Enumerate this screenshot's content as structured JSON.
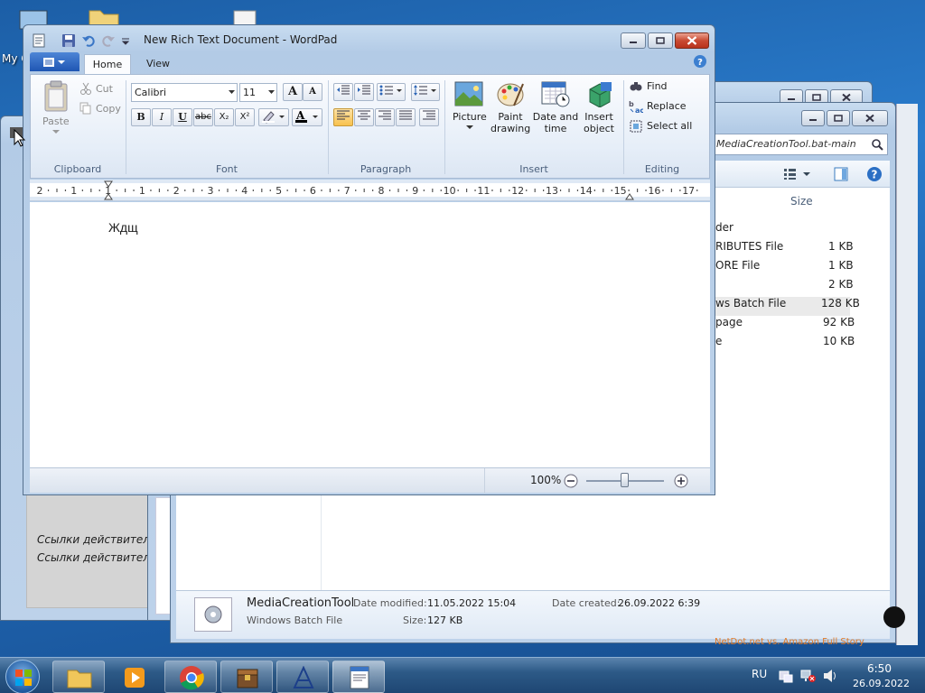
{
  "desktop": {
    "icon_label": "My C"
  },
  "back_window": {
    "italic_lines": [
      "Ссылки действитель",
      "Ссылки действитель"
    ]
  },
  "explorer": {
    "search_text": "MediaCreationTool.bat-main",
    "column_size": "Size",
    "rows": [
      {
        "type": "der",
        "size": ""
      },
      {
        "type": "RIBUTES File",
        "size": "1 KB"
      },
      {
        "type": "ORE File",
        "size": "1 KB"
      },
      {
        "type": "",
        "size": "2 KB"
      },
      {
        "type": "ws Batch File",
        "size": "128 KB"
      },
      {
        "type": "page",
        "size": "92 KB"
      },
      {
        "type": "e",
        "size": "10 KB"
      }
    ],
    "details": {
      "name": "MediaCreationTool",
      "type": "Windows Batch File",
      "modified_label": "Date modified:",
      "modified_value": "11.05.2022 15:04",
      "size_label": "Size:",
      "size_value": "127 KB",
      "created_label": "Date created:",
      "created_value": "26.09.2022 6:39"
    },
    "footer_text": "NetDot.net vs. Amazon Full Story"
  },
  "wordpad": {
    "title": "New Rich Text Document - WordPad",
    "tabs": [
      "Home",
      "View"
    ],
    "clipboard": {
      "paste": "Paste",
      "cut": "Cut",
      "copy": "Copy",
      "group": "Clipboard"
    },
    "font": {
      "family": "Calibri",
      "size": "11",
      "group": "Font"
    },
    "paragraph": {
      "group": "Paragraph"
    },
    "insert": {
      "picture": "Picture",
      "paint": "Paint drawing",
      "datetime": "Date and time",
      "object": "Insert object",
      "group": "Insert"
    },
    "editing": {
      "find": "Find",
      "replace": "Replace",
      "selectall": "Select all",
      "group": "Editing"
    },
    "ruler_numbers": [
      "2",
      "1",
      "1",
      "1",
      "2",
      "3",
      "4",
      "5",
      "6",
      "7",
      "8",
      "9",
      "10",
      "11",
      "12",
      "13",
      "14",
      "15",
      "16",
      "17"
    ],
    "document_text": "Ждщ",
    "zoom": "100%"
  },
  "taskbar": {
    "lang": "RU",
    "time": "6:50",
    "date": "26.09.2022"
  }
}
